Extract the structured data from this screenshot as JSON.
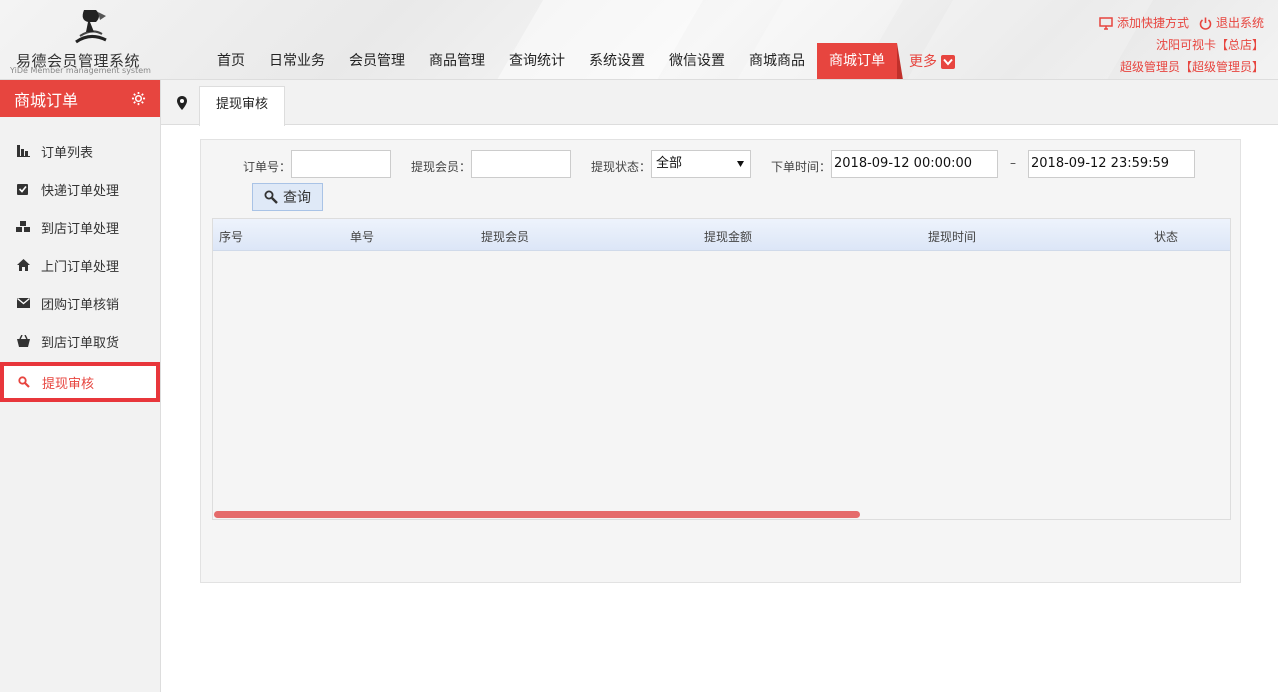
{
  "header": {
    "logo_title": "易德会员管理系统",
    "logo_subtitle": "YiDe Member management system",
    "nav": [
      "首页",
      "日常业务",
      "会员管理",
      "商品管理",
      "查询统计",
      "系统设置",
      "微信设置",
      "商城商品",
      "商城订单"
    ],
    "nav_active_index": 8,
    "nav_more": "更多",
    "add_shortcut": "添加快捷方式",
    "logout": "退出系统",
    "store": "沈阳可视卡【总店】",
    "user": "超级管理员【超级管理员】"
  },
  "sidebar": {
    "title": "商城订单",
    "items": [
      {
        "label": "订单列表",
        "icon": "bar-chart-icon"
      },
      {
        "label": "快递订单处理",
        "icon": "check-square-icon"
      },
      {
        "label": "到店订单处理",
        "icon": "cubes-icon"
      },
      {
        "label": "上门订单处理",
        "icon": "home-icon"
      },
      {
        "label": "团购订单核销",
        "icon": "envelope-icon"
      },
      {
        "label": "到店订单取货",
        "icon": "basket-icon"
      },
      {
        "label": "提现审核",
        "icon": "search-icon"
      }
    ],
    "active_index": 6
  },
  "tabbar": {
    "tab": "提现审核"
  },
  "filters": {
    "order_no_label": "订单号：",
    "order_no_value": "",
    "member_label": "提现会员：",
    "member_value": "",
    "status_label": "提现状态：",
    "status_value": "全部",
    "time_label": "下单时间：",
    "time_start": "2018-09-12 00:00:00",
    "time_sep": "–",
    "time_end": "2018-09-12 23:59:59",
    "search_button": "查询"
  },
  "grid": {
    "columns": [
      "序号",
      "单号",
      "提现会员",
      "提现金额",
      "提现时间",
      "状态"
    ],
    "rows": []
  },
  "colors": {
    "accent": "#e7453f",
    "active_border": "#e8363b"
  }
}
